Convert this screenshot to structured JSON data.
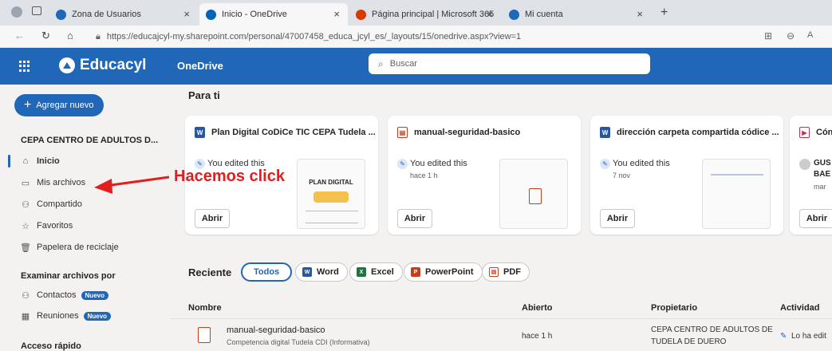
{
  "browser": {
    "tabs": [
      {
        "label": "Zona de Usuarios",
        "color": "#2167b8"
      },
      {
        "label": "Inicio - OneDrive",
        "color": "#0364b8"
      },
      {
        "label": "Página principal | Microsoft 365",
        "color": "#d83b01"
      },
      {
        "label": "Mi cuenta",
        "color": "#2167b8"
      }
    ],
    "url": "https://educajcyl-my.sharepoint.com/personal/47007458_educa_jcyl_es/_layouts/15/onedrive.aspx?view=1"
  },
  "suite": {
    "brand": "Educacyl",
    "app": "OneDrive",
    "search_placeholder": "Buscar",
    "color": "#2167b8"
  },
  "sidebar": {
    "new_button": "Agregar nuevo",
    "org": "CEPA CENTRO DE ADULTOS D...",
    "items": [
      {
        "label": "Inicio",
        "icon": "home-icon"
      },
      {
        "label": "Mis archivos",
        "icon": "folder-icon"
      },
      {
        "label": "Compartido",
        "icon": "people-icon"
      },
      {
        "label": "Favoritos",
        "icon": "star-icon"
      },
      {
        "label": "Papelera de reciclaje",
        "icon": "trash-icon"
      }
    ],
    "browse_title": "Examinar archivos por",
    "browse": [
      {
        "label": "Contactos",
        "badge": "Nuevo"
      },
      {
        "label": "Reuniones",
        "badge": "Nuevo"
      }
    ],
    "quick": "Acceso rápido"
  },
  "main": {
    "for_you": "Para ti",
    "cards": [
      {
        "title": "Plan Digital CoDiCe TIC CEPA Tudela ...",
        "type": "W",
        "edited": "You edited this",
        "time": "",
        "thumb_text": "PLAN DIGITAL"
      },
      {
        "title": "manual-seguridad-basico",
        "type": "P",
        "edited": "You edited this",
        "time": "hace 1 h",
        "thumb_text": ""
      },
      {
        "title": "dirección carpeta compartida códice ...",
        "type": "W",
        "edited": "You edited this",
        "time": "7 nov",
        "thumb_text": ""
      },
      {
        "title": "Cón",
        "type": "V",
        "edited": "GUS",
        "time": "BAE",
        "thumb_text": "mar"
      }
    ],
    "open_label": "Abrir",
    "recent": "Reciente",
    "filters": [
      "Todos",
      "Word",
      "Excel",
      "PowerPoint",
      "PDF"
    ],
    "columns": [
      "Nombre",
      "Abierto",
      "Propietario",
      "Actividad"
    ],
    "rows": [
      {
        "name": "manual-seguridad-basico",
        "location": "Competencia digital Tudela CDI (Informativa)",
        "opened": "hace 1 h",
        "owner_1": "CEPA CENTRO DE ADULTOS DE",
        "owner_2": "TUDELA DE DUERO",
        "activity": "Lo ha edit"
      }
    ]
  },
  "annotation": "Hacemos click"
}
